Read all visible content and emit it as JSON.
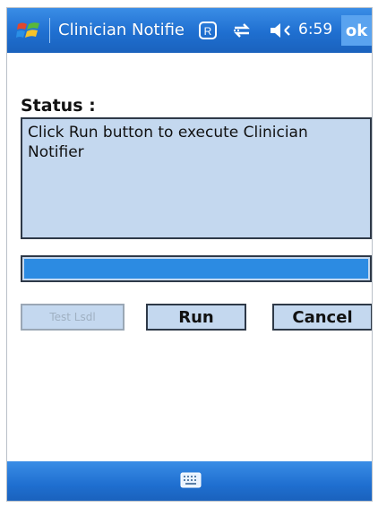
{
  "titlebar": {
    "title": "Clinician Notifie",
    "clock": "6:59",
    "ok_label": "ok",
    "icons": [
      "windows-start-icon",
      "roaming-icon",
      "connectivity-icon",
      "speaker-icon"
    ]
  },
  "status": {
    "label": "Status :",
    "message": "Click Run button to execute Clinician Notifier"
  },
  "progress": {
    "value": 1.0
  },
  "buttons": {
    "first_label": "Test Lsdl",
    "run_label": "Run",
    "cancel_label": "Cancel"
  },
  "bottombar": {
    "icons": [
      "keyboard-icon"
    ]
  },
  "colors": {
    "titlebar": "#1f6fd0",
    "field_bg": "#c4d8ef",
    "progress_fill": "#2c8be2"
  }
}
